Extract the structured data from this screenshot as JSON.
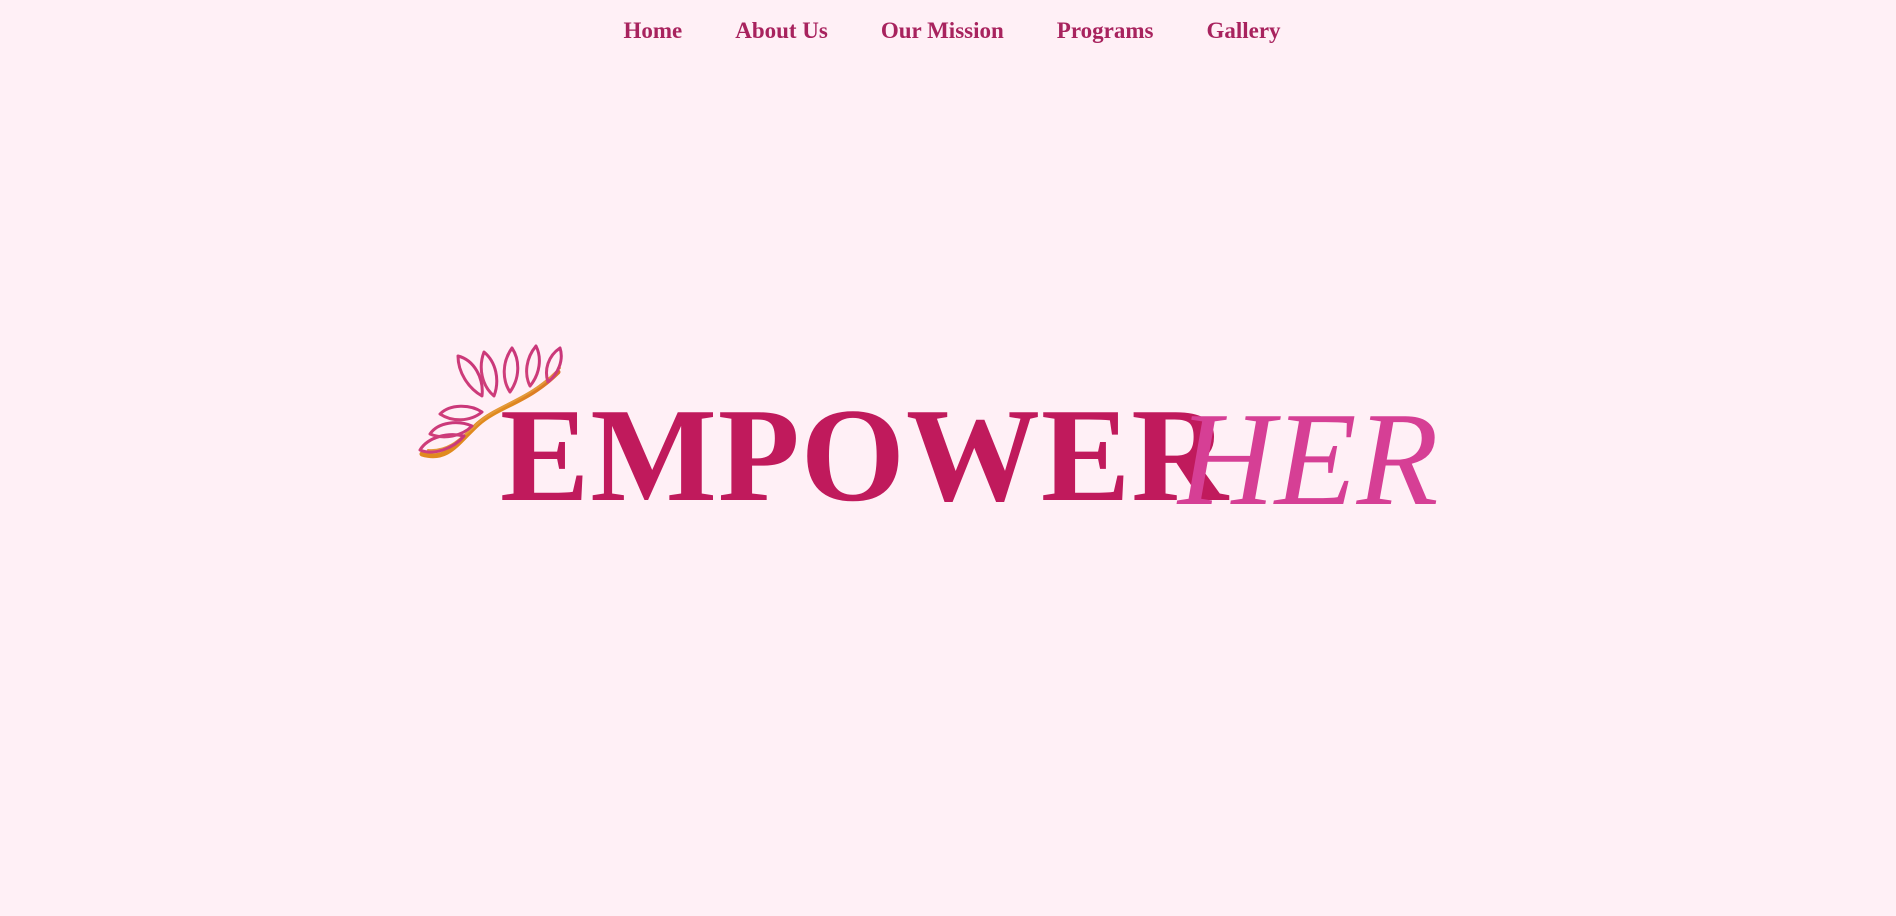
{
  "nav": {
    "items": [
      {
        "label": "Home"
      },
      {
        "label": "About Us"
      },
      {
        "label": "Our Mission"
      },
      {
        "label": "Programs"
      },
      {
        "label": "Gallery"
      }
    ]
  },
  "hero": {
    "title_main": "EMPOWER",
    "title_accent": "HER",
    "logo_icon": "lotus-leaves-icon"
  },
  "colors": {
    "background": "#fff0f6",
    "nav_text": "#a8235e",
    "title_main": "#c01a5c",
    "title_accent": "#d63f95",
    "logo_pink": "#c8357a",
    "logo_orange": "#e08a1e"
  }
}
